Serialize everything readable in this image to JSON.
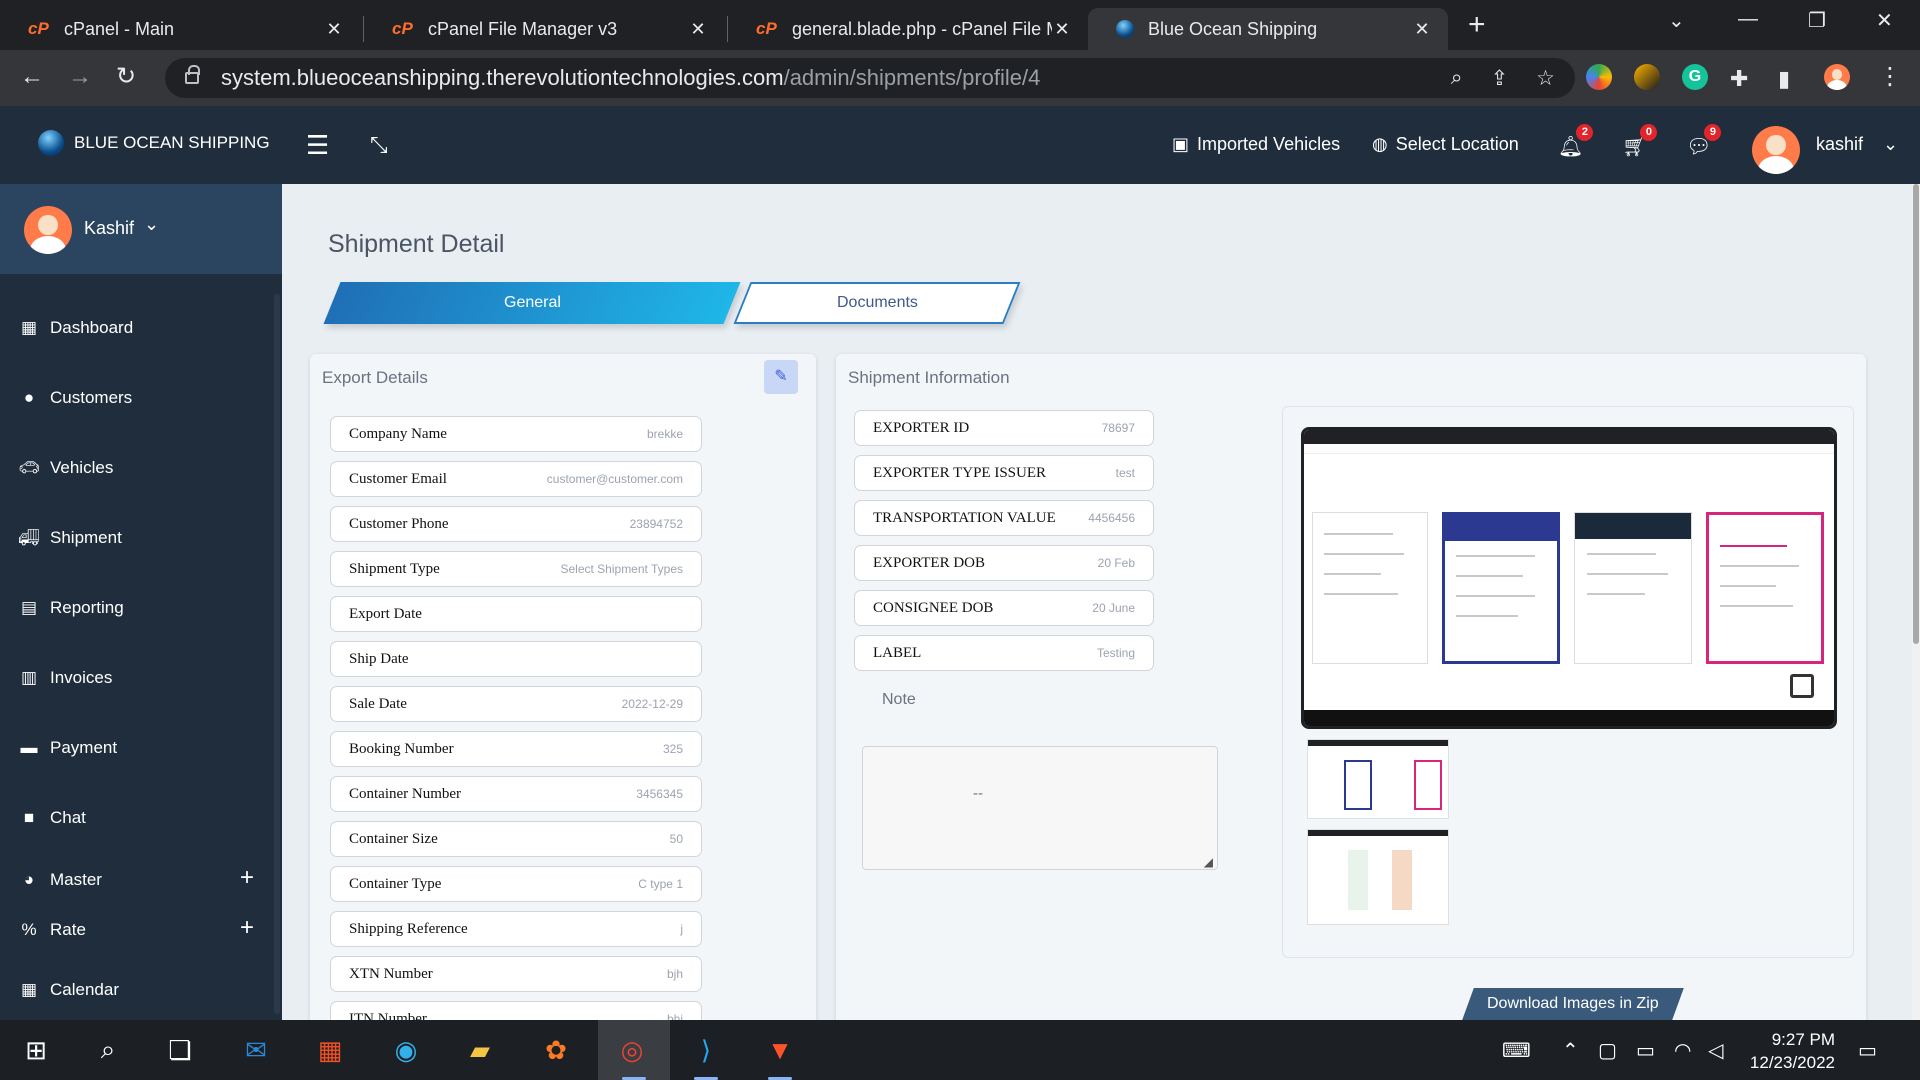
{
  "browser": {
    "tabs": [
      {
        "label": "cPanel - Main"
      },
      {
        "label": "cPanel File Manager v3"
      },
      {
        "label": "general.blade.php - cPanel File M"
      },
      {
        "label": "Blue Ocean Shipping"
      }
    ],
    "url_host": "system.blueoceanshipping.therevolutiontechnologies.com",
    "url_path": "/admin/shipments/profile/4"
  },
  "header": {
    "brand": "BLUE OCEAN SHIPPING",
    "imported_vehicles": "Imported Vehicles",
    "select_location": "Select Location",
    "notifications_count": "2",
    "cart_count": "0",
    "messages_count": "9",
    "user_name": "kashif"
  },
  "sidebar": {
    "user_name": "Kashif",
    "items": [
      {
        "label": "Dashboard",
        "icon": "calendar-icon"
      },
      {
        "label": "Customers",
        "icon": "user-icon"
      },
      {
        "label": "Vehicles",
        "icon": "car-icon"
      },
      {
        "label": "Shipment",
        "icon": "truck-icon"
      },
      {
        "label": "Reporting",
        "icon": "inbox-icon"
      },
      {
        "label": "Invoices",
        "icon": "invoice-icon"
      },
      {
        "label": "Payment",
        "icon": "card-icon"
      },
      {
        "label": "Chat",
        "icon": "chat-icon"
      },
      {
        "label": "Master",
        "icon": "pie-icon"
      },
      {
        "label": "Rate",
        "icon": "percent-icon"
      },
      {
        "label": "Calendar",
        "icon": "calendar-icon"
      }
    ]
  },
  "page": {
    "title": "Shipment Detail",
    "tab_general": "General",
    "tab_documents": "Documents"
  },
  "export_details": {
    "title": "Export Details",
    "rows": [
      {
        "label": "Company Name",
        "value": "brekke"
      },
      {
        "label": "Customer Email",
        "value": "customer@customer.com"
      },
      {
        "label": "Customer Phone",
        "value": "23894752"
      },
      {
        "label": "Shipment Type",
        "value": "Select Shipment Types"
      },
      {
        "label": "Export Date",
        "value": ""
      },
      {
        "label": "Ship Date",
        "value": ""
      },
      {
        "label": "Sale Date",
        "value": "2022-12-29"
      },
      {
        "label": "Booking Number",
        "value": "325"
      },
      {
        "label": "Container Number",
        "value": "3456345"
      },
      {
        "label": "Container Size",
        "value": "50"
      },
      {
        "label": "Container Type",
        "value": "C type 1"
      },
      {
        "label": "Shipping Reference",
        "value": "j"
      },
      {
        "label": "XTN Number",
        "value": "bjh"
      },
      {
        "label": "ITN Number",
        "value": "bhj"
      }
    ]
  },
  "shipment_info": {
    "title": "Shipment Information",
    "rows": [
      {
        "label": "EXPORTER ID",
        "value": "78697"
      },
      {
        "label": "EXPORTER TYPE ISSUER",
        "value": "test"
      },
      {
        "label": "TRANSPORTATION VALUE",
        "value": "4456456"
      },
      {
        "label": "EXPORTER DOB",
        "value": "20 Feb"
      },
      {
        "label": "CONSIGNEE DOB",
        "value": "20 June"
      },
      {
        "label": "LABEL",
        "value": "Testing"
      }
    ],
    "note_label": "Note",
    "note_value": "--"
  },
  "gallery": {
    "download_label": "Download Images in Zip"
  },
  "taskbar": {
    "time": "9:27 PM",
    "date": "12/23/2022"
  }
}
